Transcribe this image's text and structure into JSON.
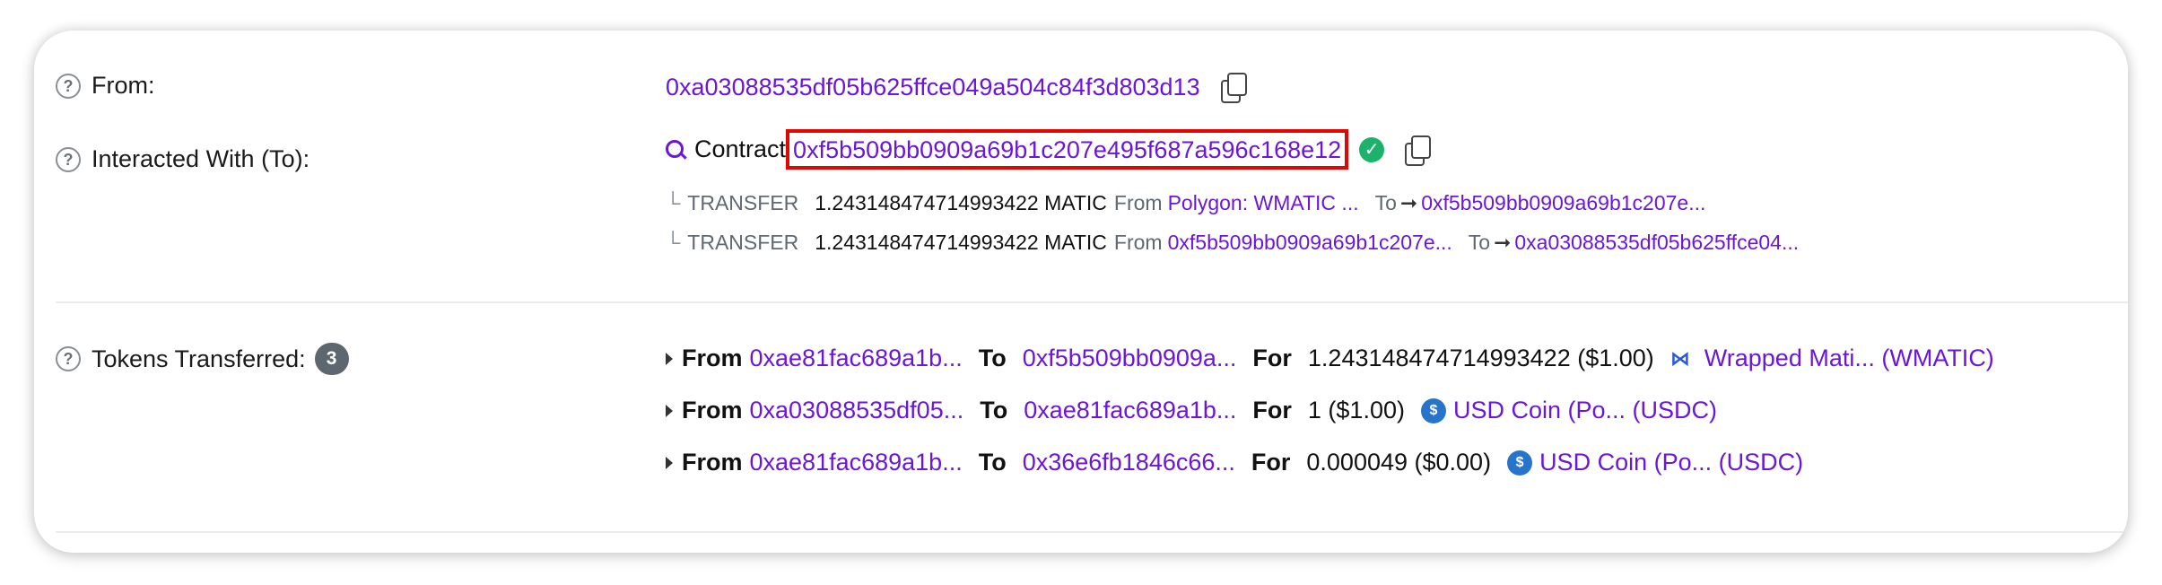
{
  "from": {
    "label": "From:",
    "address": "0xa03088535df05b625ffce049a504c84f3d803d13"
  },
  "interacted": {
    "label": "Interacted With (To):",
    "prefix": "Contract",
    "address": "0xf5b509bb0909a69b1c207e495f687a596c168e12",
    "transfers": [
      {
        "kind": "TRANSFER",
        "amount": "1.243148474714993422 MATIC",
        "from_label": "From",
        "from_value": "Polygon: WMATIC ...",
        "to_label": "To",
        "to_value": "0xf5b509bb0909a69b1c207e..."
      },
      {
        "kind": "TRANSFER",
        "amount": "1.243148474714993422 MATIC",
        "from_label": "From",
        "from_value": "0xf5b509bb0909a69b1c207e...",
        "to_label": "To",
        "to_value": "0xa03088535df05b625ffce04..."
      }
    ]
  },
  "tokens": {
    "label": "Tokens Transferred:",
    "count": "3",
    "rows": [
      {
        "from_label": "From",
        "from": "0xae81fac689a1b...",
        "to_label": "To",
        "to": "0xf5b509bb0909a...",
        "for_label": "For",
        "amount": "1.243148474714993422 ($1.00)",
        "token": "Wrapped Mati... (WMATIC)",
        "token_icon": "polygon-matic-icon"
      },
      {
        "from_label": "From",
        "from": "0xa03088535df05...",
        "to_label": "To",
        "to": "0xae81fac689a1b...",
        "for_label": "For",
        "amount": "1 ($1.00)",
        "token": "USD Coin (Po... (USDC)",
        "token_icon": "usdc-coin-icon"
      },
      {
        "from_label": "From",
        "from": "0xae81fac689a1b...",
        "to_label": "To",
        "to": "0x36e6fb1846c66...",
        "for_label": "For",
        "amount": "0.000049 ($0.00)",
        "token": "USD Coin (Po... (USDC)",
        "token_icon": "usdc-coin-icon"
      }
    ]
  },
  "colors": {
    "link": "#6b16d9",
    "highlight_border": "#e10600",
    "verified": "#1bb36b"
  }
}
